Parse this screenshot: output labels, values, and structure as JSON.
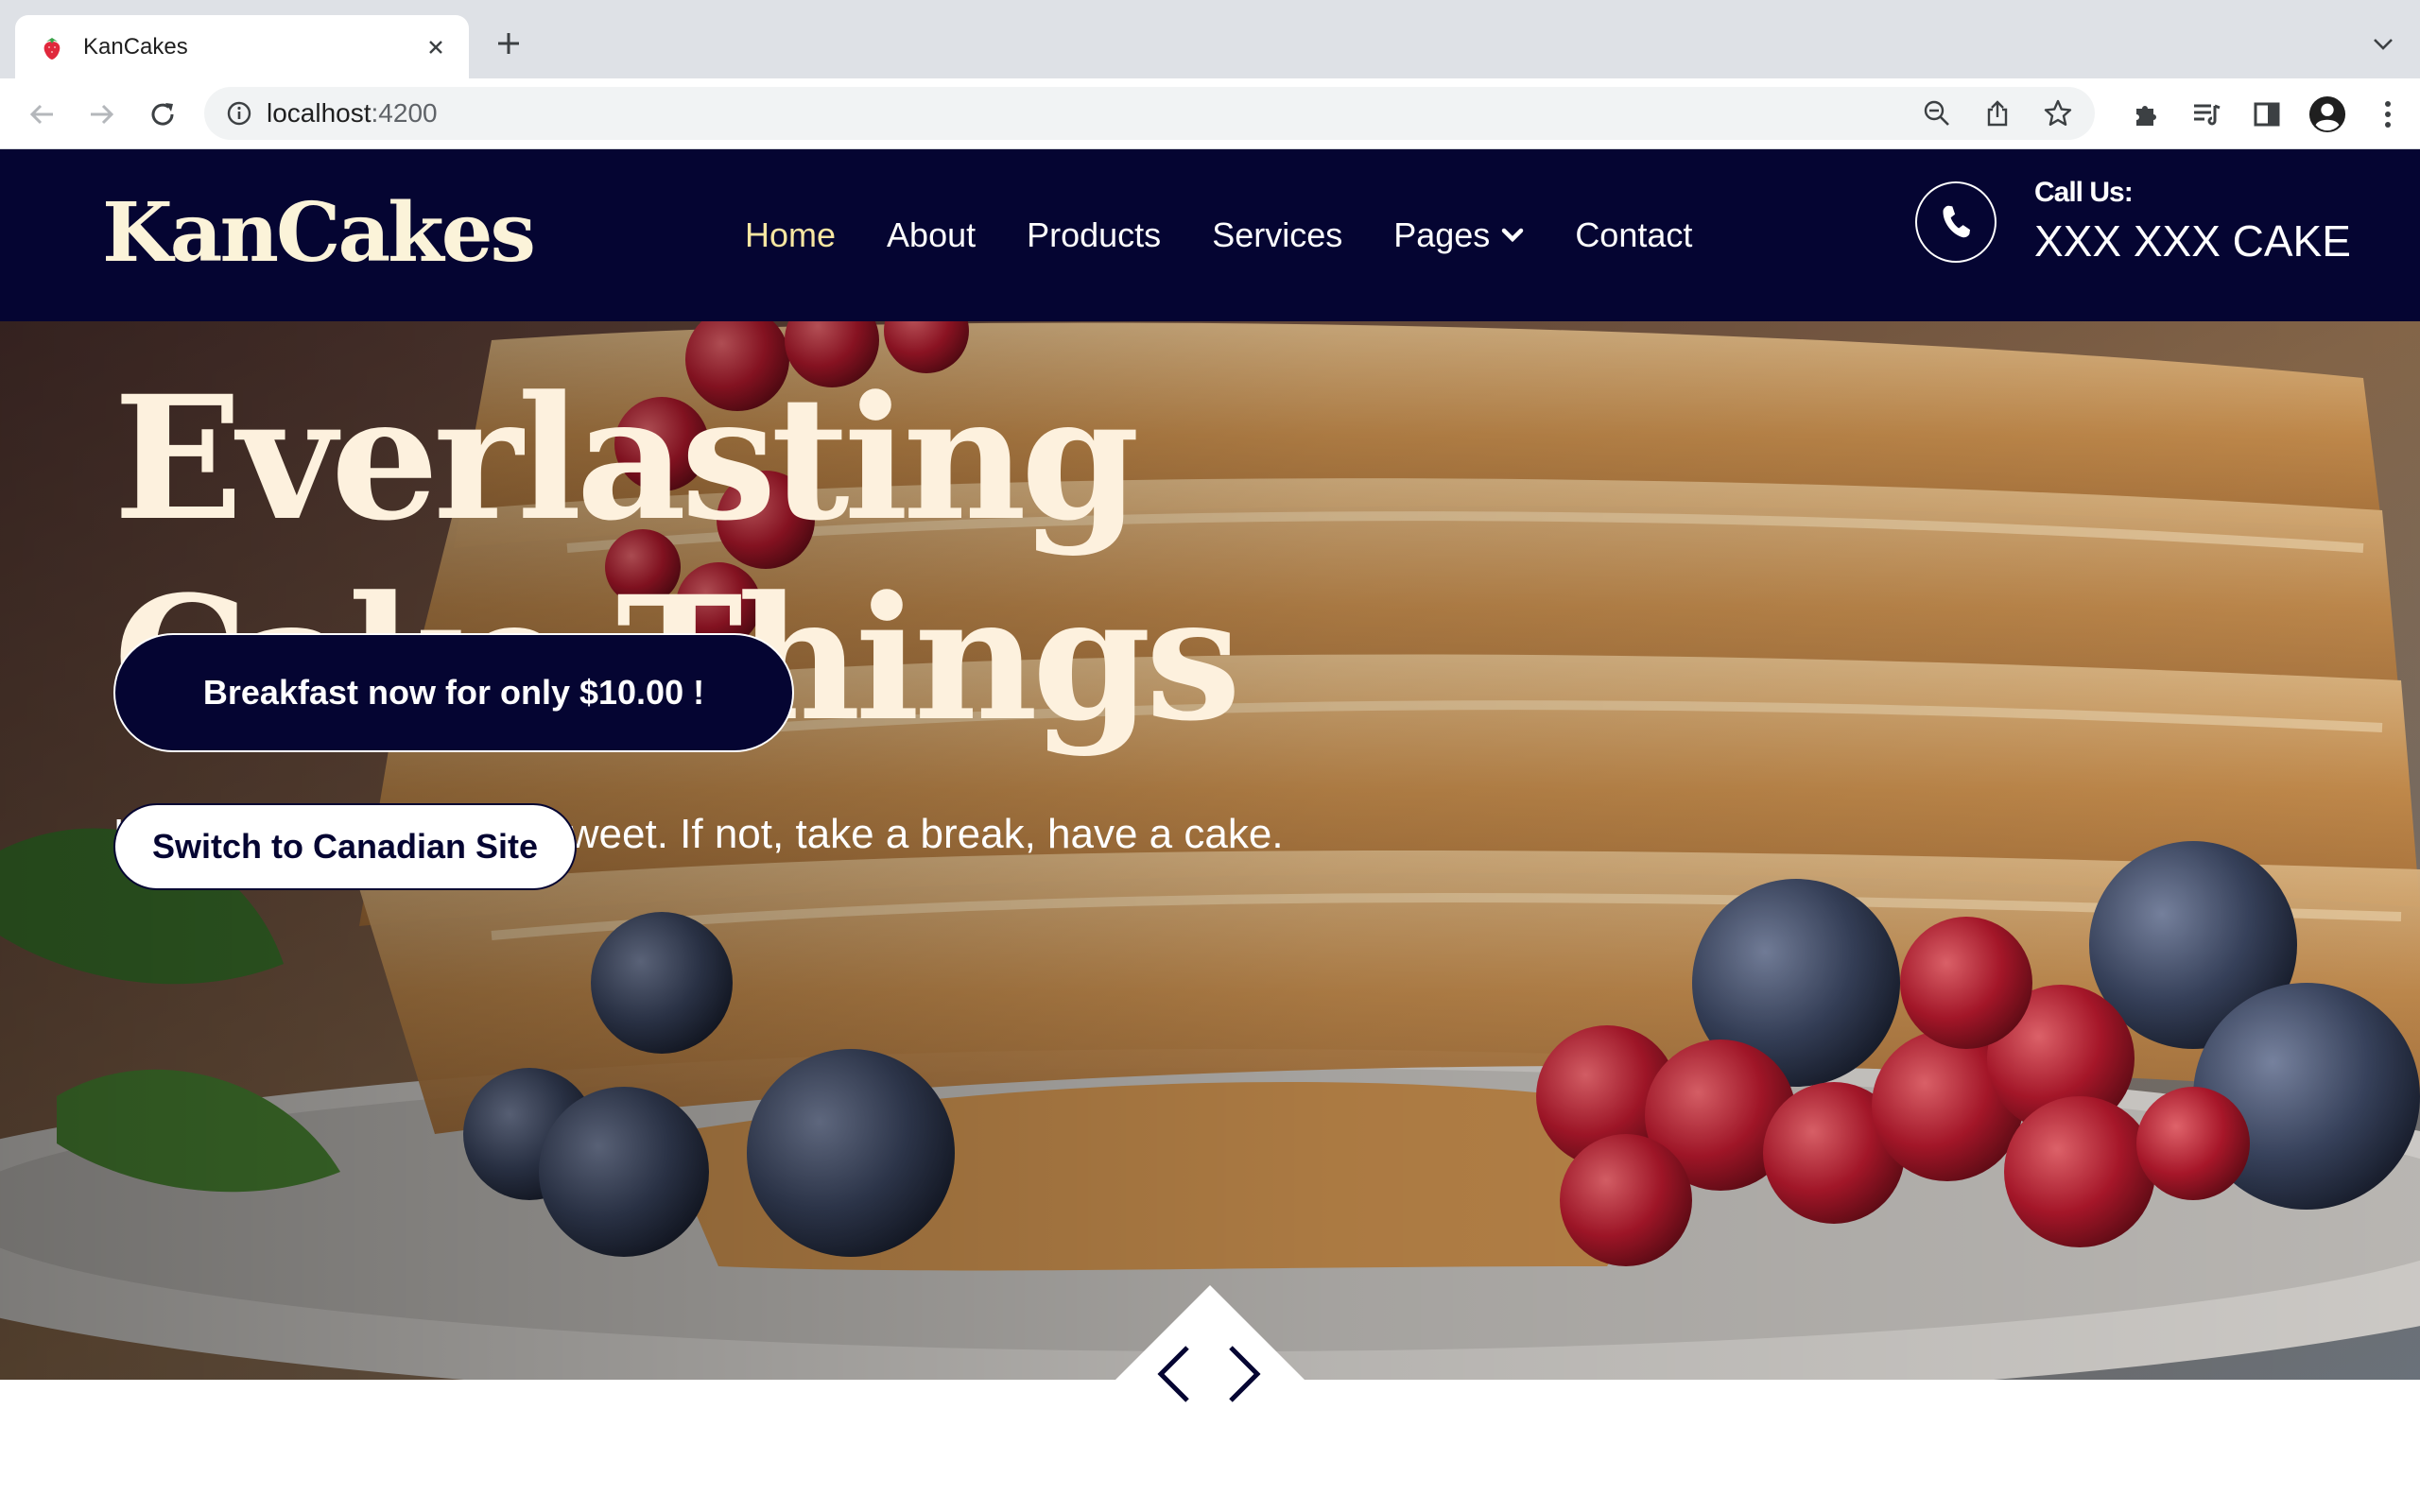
{
  "browser": {
    "tab_title": "KanCakes",
    "favicon": "strawberry-icon",
    "url_host": "localhost",
    "url_port": ":4200"
  },
  "site": {
    "logo": "KanCakes",
    "nav": [
      {
        "label": "Home",
        "active": true
      },
      {
        "label": "About"
      },
      {
        "label": "Products"
      },
      {
        "label": "Services"
      },
      {
        "label": "Pages",
        "has_dropdown": true
      },
      {
        "label": "Contact"
      }
    ],
    "call_label": "Call Us:",
    "call_number": "XXX XXX CAKE"
  },
  "hero": {
    "title_line1": "Everlasting",
    "title_line2": "Cake Things",
    "subtitle": "Life is sweet, savor the sweet. If not, take a break, have a cake.",
    "primary_button": "Breakfast now for only $10.00 !",
    "secondary_button": "Switch to Canadian Site"
  },
  "colors": {
    "navy": "#050532",
    "cream": "#fbf3d9",
    "active_nav": "#f7e6a1"
  }
}
